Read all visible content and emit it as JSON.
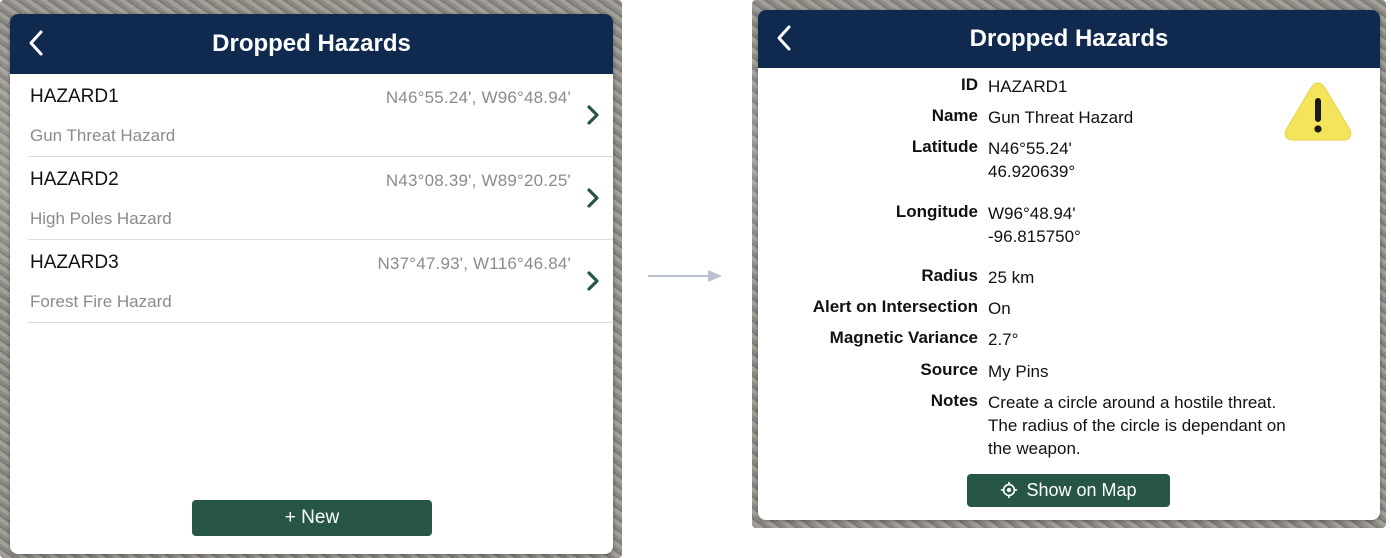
{
  "left": {
    "title": "Dropped Hazards",
    "hazards": [
      {
        "id": "HAZARD1",
        "name": "Gun Threat Hazard",
        "coords": "N46°55.24',  W96°48.94'"
      },
      {
        "id": "HAZARD2",
        "name": "High Poles Hazard",
        "coords": "N43°08.39',  W89°20.25'"
      },
      {
        "id": "HAZARD3",
        "name": "Forest Fire Hazard",
        "coords": "N37°47.93',  W116°46.84'"
      }
    ],
    "new_button": "+  New"
  },
  "right": {
    "title": "Dropped Hazards",
    "details": {
      "id_label": "ID",
      "id_value": "HAZARD1",
      "name_label": "Name",
      "name_value": "Gun Threat Hazard",
      "lat_label": "Latitude",
      "lat_value": "N46°55.24'\n46.920639°",
      "lon_label": "Longitude",
      "lon_value": "W96°48.94'\n-96.815750°",
      "radius_label": "Radius",
      "radius_value": "25 km",
      "alert_label": "Alert on Intersection",
      "alert_value": "On",
      "magvar_label": "Magnetic Variance",
      "magvar_value": "2.7°",
      "source_label": "Source",
      "source_value": "My Pins",
      "notes_label": "Notes",
      "notes_value": "Create a circle around a hostile threat.\nThe radius of the circle is dependant on\nthe weapon."
    },
    "show_on_map": "Show on Map"
  },
  "colors": {
    "nav_bar": "#10294f",
    "button": "#275645",
    "chevron": "#275645",
    "warning_fill": "#f4e45a"
  },
  "icons": [
    "back-chevron-icon",
    "chevron-right-icon",
    "warning-icon",
    "locate-icon",
    "arrow-right-icon"
  ]
}
